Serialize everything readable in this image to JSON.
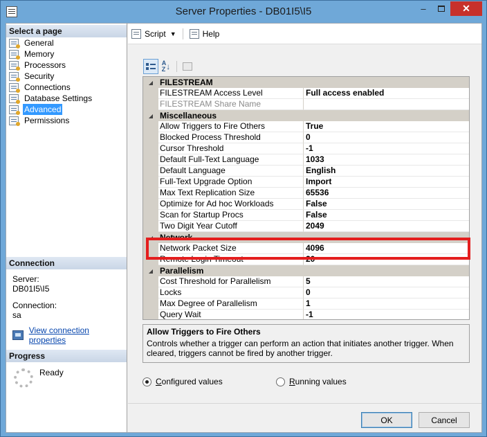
{
  "window": {
    "title": "Server Properties - DB01I5\\I5",
    "controls": {
      "minimize": "–",
      "close": "✕"
    }
  },
  "sidebar": {
    "select_page_heading": "Select a page",
    "pages": [
      {
        "label": "General",
        "icon": "page-icon"
      },
      {
        "label": "Memory",
        "icon": "page-icon"
      },
      {
        "label": "Processors",
        "icon": "page-icon"
      },
      {
        "label": "Security",
        "icon": "page-icon"
      },
      {
        "label": "Connections",
        "icon": "page-icon"
      },
      {
        "label": "Database Settings",
        "icon": "page-icon"
      },
      {
        "label": "Advanced",
        "icon": "page-icon",
        "selected": true
      },
      {
        "label": "Permissions",
        "icon": "page-icon"
      }
    ],
    "connection_heading": "Connection",
    "server_label": "Server:",
    "server_value": "DB01I5\\I5",
    "connection_label": "Connection:",
    "connection_value": "sa",
    "view_link": "View connection properties",
    "progress_heading": "Progress",
    "progress_status": "Ready"
  },
  "toolbar": {
    "script_label": "Script",
    "help_label": "Help"
  },
  "grid": {
    "rows": [
      {
        "kind": "cat",
        "name": "FILESTREAM"
      },
      {
        "kind": "prop",
        "name": "FILESTREAM Access Level",
        "value": "Full access enabled"
      },
      {
        "kind": "prop",
        "name": "FILESTREAM Share Name",
        "value": "",
        "disabled": true
      },
      {
        "kind": "cat",
        "name": "Miscellaneous"
      },
      {
        "kind": "prop",
        "name": "Allow Triggers to Fire Others",
        "value": "True"
      },
      {
        "kind": "prop",
        "name": "Blocked Process Threshold",
        "value": "0"
      },
      {
        "kind": "prop",
        "name": "Cursor Threshold",
        "value": "-1"
      },
      {
        "kind": "prop",
        "name": "Default Full-Text Language",
        "value": "1033"
      },
      {
        "kind": "prop",
        "name": "Default Language",
        "value": "English"
      },
      {
        "kind": "prop",
        "name": "Full-Text Upgrade Option",
        "value": "Import"
      },
      {
        "kind": "prop",
        "name": "Max Text Replication Size",
        "value": "65536"
      },
      {
        "kind": "prop",
        "name": "Optimize for Ad hoc Workloads",
        "value": "False"
      },
      {
        "kind": "prop",
        "name": "Scan for Startup Procs",
        "value": "False"
      },
      {
        "kind": "prop",
        "name": "Two Digit Year Cutoff",
        "value": "2049"
      },
      {
        "kind": "cat",
        "name": "Network"
      },
      {
        "kind": "prop",
        "name": "Network Packet Size",
        "value": "4096"
      },
      {
        "kind": "prop",
        "name": "Remote Login Timeout",
        "value": "20"
      },
      {
        "kind": "cat",
        "name": "Parallelism"
      },
      {
        "kind": "prop",
        "name": "Cost Threshold for Parallelism",
        "value": "5"
      },
      {
        "kind": "prop",
        "name": "Locks",
        "value": "0"
      },
      {
        "kind": "prop",
        "name": "Max Degree of Parallelism",
        "value": "1"
      },
      {
        "kind": "prop",
        "name": "Query Wait",
        "value": "-1"
      }
    ],
    "highlight_color": "#e41e1e"
  },
  "description": {
    "title": "Allow Triggers to Fire Others",
    "text": "Controls whether a trigger can perform an action that initiates another trigger. When cleared, triggers cannot be fired by another trigger."
  },
  "options": {
    "configured_label_u": "C",
    "configured_label_rest": "onfigured values",
    "running_label_u": "R",
    "running_label_rest": "unning values",
    "selected": "configured"
  },
  "buttons": {
    "ok": "OK",
    "cancel": "Cancel"
  }
}
